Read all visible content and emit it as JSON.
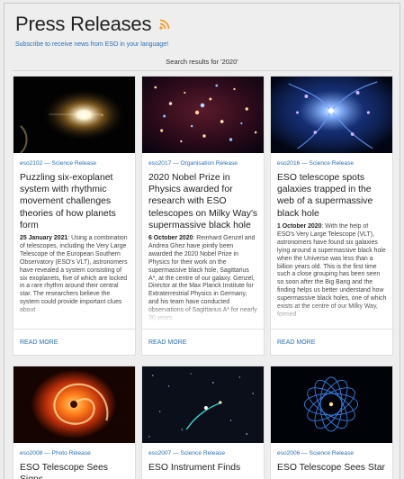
{
  "header": {
    "title": "Press Releases",
    "subscribe_text": "Subscribe to receive news from ESO in your language!",
    "search_results": "Search results for '2020'"
  },
  "colors": {
    "link": "#2a6fb7",
    "rss": "#f39a1e",
    "background": "#eeeeee"
  },
  "cards": [
    {
      "meta": "eso2102 — Science Release",
      "title": "Puzzling six-exoplanet system with rhythmic movement challenges theories of how planets form",
      "date": "25 January 2021",
      "excerpt": "Using a combination of telescopes, including the Very Large Telescope of the European Southern Observatory (ESO's VLT), astronomers have revealed a system consisting of six exoplanets, five of which are locked in a rare rhythm around their central star. The researchers believe the system could provide important clues about",
      "read_more": "READ MORE"
    },
    {
      "meta": "eso2017 — Organisation Release",
      "title": "2020 Nobel Prize in Physics awarded for research with ESO telescopes on Milky Way's supermassive black hole",
      "date": "6 October 2020",
      "excerpt": "Reinhard Genzel and Andrea Ghez have jointly been awarded the 2020 Nobel Prize in Physics for their work on the supermassive black hole, Sagittarius A*, at the centre of our galaxy. Genzel, Director at the Max Planck Institute for Extraterrestrial Physics in Germany, and his team have conducted observations of Sagittarius A* for nearly 30 years",
      "read_more": "READ MORE"
    },
    {
      "meta": "eso2016 — Science Release",
      "title": "ESO telescope spots galaxies trapped in the web of a supermassive black hole",
      "date": "1 October 2020",
      "excerpt": "With the help of ESO's Very Large Telescope (VLT), astronomers have found six galaxies lying around a supermassive black hole when the Universe was less than a billion years old. This is the first time such a close grouping has been seen so soon after the Big Bang and the finding helps us better understand how supermassive black holes, one of which exists at the centre of our Milky Way, formed",
      "read_more": "READ MORE"
    },
    {
      "meta": "eso2008 — Photo Release",
      "title": "ESO Telescope Sees Signs"
    },
    {
      "meta": "eso2007 — Science Release",
      "title": "ESO Instrument Finds"
    },
    {
      "meta": "eso2006 — Science Release",
      "title": "ESO Telescope Sees Star"
    }
  ]
}
